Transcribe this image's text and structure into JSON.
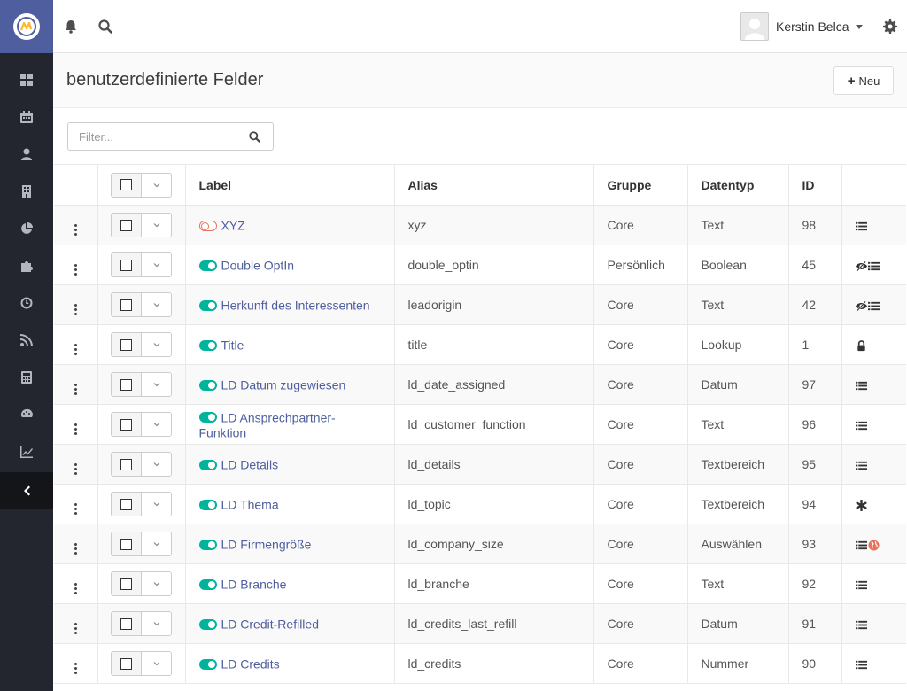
{
  "app": {
    "user_name": "Kerstin Belca",
    "brand_color": "#4e5e9e",
    "accent_color": "#00b49c"
  },
  "sidebar": {
    "items": [
      {
        "icon": "dashboard-icon"
      },
      {
        "icon": "calendar-icon"
      },
      {
        "icon": "user-icon"
      },
      {
        "icon": "building-icon"
      },
      {
        "icon": "pie-chart-icon"
      },
      {
        "icon": "puzzle-icon"
      },
      {
        "icon": "clock-icon"
      },
      {
        "icon": "rss-icon"
      },
      {
        "icon": "calculator-icon"
      },
      {
        "icon": "palette-icon"
      },
      {
        "icon": "line-chart-icon"
      }
    ],
    "collapse_icon": "chevron-left-icon"
  },
  "header": {
    "title": "benutzerdefinierte Felder",
    "new_button": "Neu"
  },
  "filter": {
    "placeholder": "Filter..."
  },
  "table": {
    "columns": [
      "Label",
      "Alias",
      "Gruppe",
      "Datentyp",
      "ID"
    ],
    "rows": [
      {
        "label": "XYZ",
        "published": false,
        "alias": "xyz",
        "group": "Core",
        "type": "Text",
        "id": "98",
        "icons": [
          "list-icon"
        ]
      },
      {
        "label": "Double OptIn",
        "published": true,
        "alias": "double_optin",
        "group": "Persönlich",
        "type": "Boolean",
        "id": "45",
        "icons": [
          "eye-slash-icon",
          "list-icon"
        ]
      },
      {
        "label": "Herkunft des Interessenten",
        "published": true,
        "alias": "leadorigin",
        "group": "Core",
        "type": "Text",
        "id": "42",
        "icons": [
          "eye-slash-icon",
          "list-icon"
        ]
      },
      {
        "label": "Title",
        "published": true,
        "alias": "title",
        "group": "Core",
        "type": "Lookup",
        "id": "1",
        "icons": [
          "lock-icon"
        ]
      },
      {
        "label": "LD Datum zugewiesen",
        "published": true,
        "alias": "ld_date_assigned",
        "group": "Core",
        "type": "Datum",
        "id": "97",
        "icons": [
          "list-icon"
        ]
      },
      {
        "label": "LD Ansprechpartner-Funktion",
        "published": true,
        "alias": "ld_customer_function",
        "group": "Core",
        "type": "Text",
        "id": "96",
        "icons": [
          "list-icon"
        ]
      },
      {
        "label": "LD Details",
        "published": true,
        "alias": "ld_details",
        "group": "Core",
        "type": "Textbereich",
        "id": "95",
        "icons": [
          "list-icon"
        ]
      },
      {
        "label": "LD Thema",
        "published": true,
        "alias": "ld_topic",
        "group": "Core",
        "type": "Textbereich",
        "id": "94",
        "icons": [
          "asterisk-icon"
        ]
      },
      {
        "label": "LD Firmengröße",
        "published": true,
        "alias": "ld_company_size",
        "group": "Core",
        "type": "Auswählen",
        "id": "93",
        "icons": [
          "list-icon",
          "globe-icon"
        ]
      },
      {
        "label": "LD Branche",
        "published": true,
        "alias": "ld_branche",
        "group": "Core",
        "type": "Text",
        "id": "92",
        "icons": [
          "list-icon"
        ]
      },
      {
        "label": "LD Credit-Refilled",
        "published": true,
        "alias": "ld_credits_last_refill",
        "group": "Core",
        "type": "Datum",
        "id": "91",
        "icons": [
          "list-icon"
        ]
      },
      {
        "label": "LD Credits",
        "published": true,
        "alias": "ld_credits",
        "group": "Core",
        "type": "Nummer",
        "id": "90",
        "icons": [
          "list-icon"
        ]
      }
    ]
  }
}
